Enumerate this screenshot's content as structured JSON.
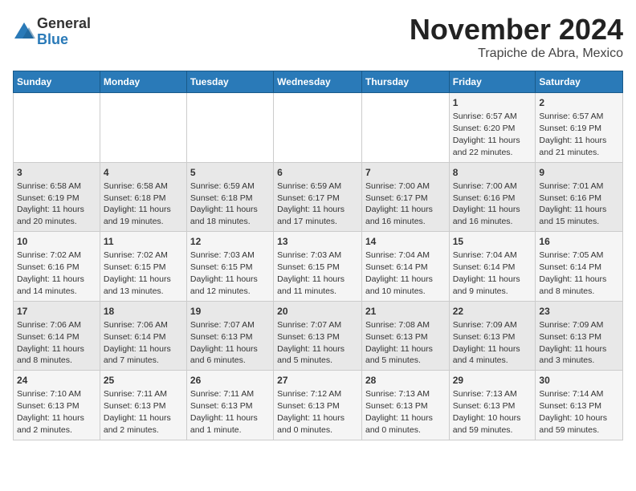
{
  "logo": {
    "general": "General",
    "blue": "Blue"
  },
  "title": "November 2024",
  "subtitle": "Trapiche de Abra, Mexico",
  "days_of_week": [
    "Sunday",
    "Monday",
    "Tuesday",
    "Wednesday",
    "Thursday",
    "Friday",
    "Saturday"
  ],
  "weeks": [
    [
      {
        "day": "",
        "info": ""
      },
      {
        "day": "",
        "info": ""
      },
      {
        "day": "",
        "info": ""
      },
      {
        "day": "",
        "info": ""
      },
      {
        "day": "",
        "info": ""
      },
      {
        "day": "1",
        "info": "Sunrise: 6:57 AM\nSunset: 6:20 PM\nDaylight: 11 hours and 22 minutes."
      },
      {
        "day": "2",
        "info": "Sunrise: 6:57 AM\nSunset: 6:19 PM\nDaylight: 11 hours and 21 minutes."
      }
    ],
    [
      {
        "day": "3",
        "info": "Sunrise: 6:58 AM\nSunset: 6:19 PM\nDaylight: 11 hours and 20 minutes."
      },
      {
        "day": "4",
        "info": "Sunrise: 6:58 AM\nSunset: 6:18 PM\nDaylight: 11 hours and 19 minutes."
      },
      {
        "day": "5",
        "info": "Sunrise: 6:59 AM\nSunset: 6:18 PM\nDaylight: 11 hours and 18 minutes."
      },
      {
        "day": "6",
        "info": "Sunrise: 6:59 AM\nSunset: 6:17 PM\nDaylight: 11 hours and 17 minutes."
      },
      {
        "day": "7",
        "info": "Sunrise: 7:00 AM\nSunset: 6:17 PM\nDaylight: 11 hours and 16 minutes."
      },
      {
        "day": "8",
        "info": "Sunrise: 7:00 AM\nSunset: 6:16 PM\nDaylight: 11 hours and 16 minutes."
      },
      {
        "day": "9",
        "info": "Sunrise: 7:01 AM\nSunset: 6:16 PM\nDaylight: 11 hours and 15 minutes."
      }
    ],
    [
      {
        "day": "10",
        "info": "Sunrise: 7:02 AM\nSunset: 6:16 PM\nDaylight: 11 hours and 14 minutes."
      },
      {
        "day": "11",
        "info": "Sunrise: 7:02 AM\nSunset: 6:15 PM\nDaylight: 11 hours and 13 minutes."
      },
      {
        "day": "12",
        "info": "Sunrise: 7:03 AM\nSunset: 6:15 PM\nDaylight: 11 hours and 12 minutes."
      },
      {
        "day": "13",
        "info": "Sunrise: 7:03 AM\nSunset: 6:15 PM\nDaylight: 11 hours and 11 minutes."
      },
      {
        "day": "14",
        "info": "Sunrise: 7:04 AM\nSunset: 6:14 PM\nDaylight: 11 hours and 10 minutes."
      },
      {
        "day": "15",
        "info": "Sunrise: 7:04 AM\nSunset: 6:14 PM\nDaylight: 11 hours and 9 minutes."
      },
      {
        "day": "16",
        "info": "Sunrise: 7:05 AM\nSunset: 6:14 PM\nDaylight: 11 hours and 8 minutes."
      }
    ],
    [
      {
        "day": "17",
        "info": "Sunrise: 7:06 AM\nSunset: 6:14 PM\nDaylight: 11 hours and 8 minutes."
      },
      {
        "day": "18",
        "info": "Sunrise: 7:06 AM\nSunset: 6:14 PM\nDaylight: 11 hours and 7 minutes."
      },
      {
        "day": "19",
        "info": "Sunrise: 7:07 AM\nSunset: 6:13 PM\nDaylight: 11 hours and 6 minutes."
      },
      {
        "day": "20",
        "info": "Sunrise: 7:07 AM\nSunset: 6:13 PM\nDaylight: 11 hours and 5 minutes."
      },
      {
        "day": "21",
        "info": "Sunrise: 7:08 AM\nSunset: 6:13 PM\nDaylight: 11 hours and 5 minutes."
      },
      {
        "day": "22",
        "info": "Sunrise: 7:09 AM\nSunset: 6:13 PM\nDaylight: 11 hours and 4 minutes."
      },
      {
        "day": "23",
        "info": "Sunrise: 7:09 AM\nSunset: 6:13 PM\nDaylight: 11 hours and 3 minutes."
      }
    ],
    [
      {
        "day": "24",
        "info": "Sunrise: 7:10 AM\nSunset: 6:13 PM\nDaylight: 11 hours and 2 minutes."
      },
      {
        "day": "25",
        "info": "Sunrise: 7:11 AM\nSunset: 6:13 PM\nDaylight: 11 hours and 2 minutes."
      },
      {
        "day": "26",
        "info": "Sunrise: 7:11 AM\nSunset: 6:13 PM\nDaylight: 11 hours and 1 minute."
      },
      {
        "day": "27",
        "info": "Sunrise: 7:12 AM\nSunset: 6:13 PM\nDaylight: 11 hours and 0 minutes."
      },
      {
        "day": "28",
        "info": "Sunrise: 7:13 AM\nSunset: 6:13 PM\nDaylight: 11 hours and 0 minutes."
      },
      {
        "day": "29",
        "info": "Sunrise: 7:13 AM\nSunset: 6:13 PM\nDaylight: 10 hours and 59 minutes."
      },
      {
        "day": "30",
        "info": "Sunrise: 7:14 AM\nSunset: 6:13 PM\nDaylight: 10 hours and 59 minutes."
      }
    ]
  ]
}
